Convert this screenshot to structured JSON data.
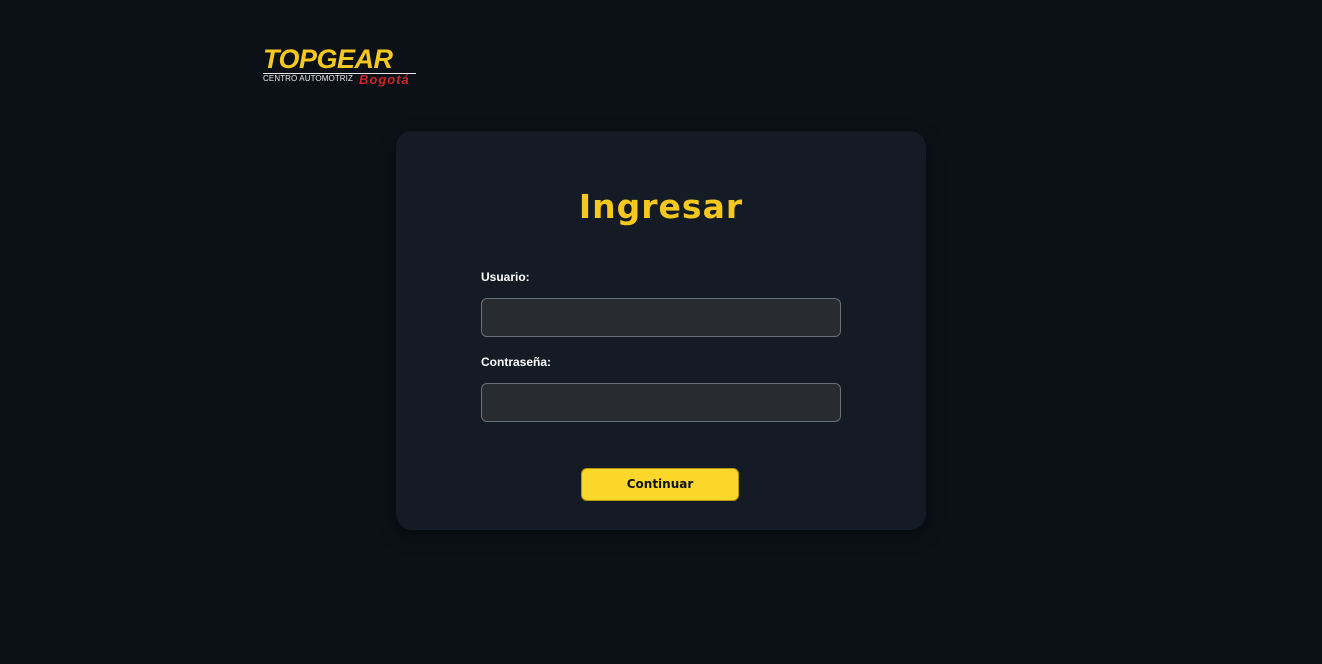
{
  "logo": {
    "brand": "TOPGEAR",
    "tagline": "CENTRO AUTOMOTRIZ",
    "city": "Bogotá"
  },
  "login": {
    "title": "Ingresar",
    "username_label": "Usuario:",
    "username_value": "",
    "password_label": "Contraseña:",
    "password_value": "",
    "submit_label": "Continuar"
  },
  "colors": {
    "background": "#0c1118",
    "card": "#141b25",
    "accent_yellow": "#f4c81e",
    "button_yellow": "#fbd72b",
    "brand_red": "#d0232a",
    "input_bg": "#282b30"
  }
}
